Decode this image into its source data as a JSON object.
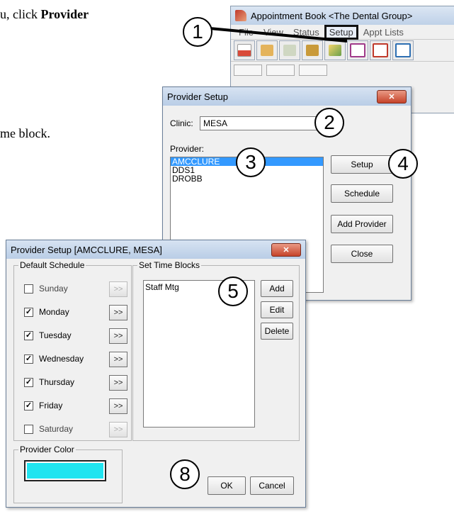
{
  "doc": {
    "line1_prefix": "u, click ",
    "line1_bold": "Provider",
    "line2": "me block."
  },
  "appt_window": {
    "title": "Appointment Book <The Dental Group>",
    "menu": [
      "File",
      "View",
      "Status",
      "Setup",
      "Appt Lists"
    ],
    "highlighted_menu": "Setup"
  },
  "provider_setup": {
    "title": "Provider Setup",
    "close_glyph": "✕",
    "clinic_label": "Clinic:",
    "clinic_value": "MESA",
    "provider_label": "Provider:",
    "providers": [
      "AMCCLURE",
      "DDS1",
      "DROBB"
    ],
    "selected_provider": "AMCCLURE",
    "buttons": {
      "setup": "Setup",
      "schedule": "Schedule",
      "add_provider": "Add Provider",
      "close": "Close"
    }
  },
  "provider_detail": {
    "title": "Provider Setup [AMCCLURE, MESA]",
    "close_glyph": "✕",
    "default_schedule_label": "Default Schedule",
    "days": [
      {
        "name": "Sunday",
        "checked": false,
        "enabled": false
      },
      {
        "name": "Monday",
        "checked": true,
        "enabled": true
      },
      {
        "name": "Tuesday",
        "checked": true,
        "enabled": true
      },
      {
        "name": "Wednesday",
        "checked": true,
        "enabled": true
      },
      {
        "name": "Thursday",
        "checked": true,
        "enabled": true
      },
      {
        "name": "Friday",
        "checked": true,
        "enabled": true
      },
      {
        "name": "Saturday",
        "checked": false,
        "enabled": false
      }
    ],
    "arrow_label": ">>",
    "check_glyph": "✓",
    "time_blocks_label": "Set Time Blocks",
    "time_blocks": [
      "Staff Mtg"
    ],
    "buttons": {
      "add": "Add",
      "edit": "Edit",
      "delete": "Delete",
      "ok": "OK",
      "cancel": "Cancel"
    },
    "provider_color_label": "Provider Color",
    "provider_color": "#21e4f0"
  },
  "callouts": [
    "1",
    "2",
    "3",
    "4",
    "5",
    "8"
  ]
}
